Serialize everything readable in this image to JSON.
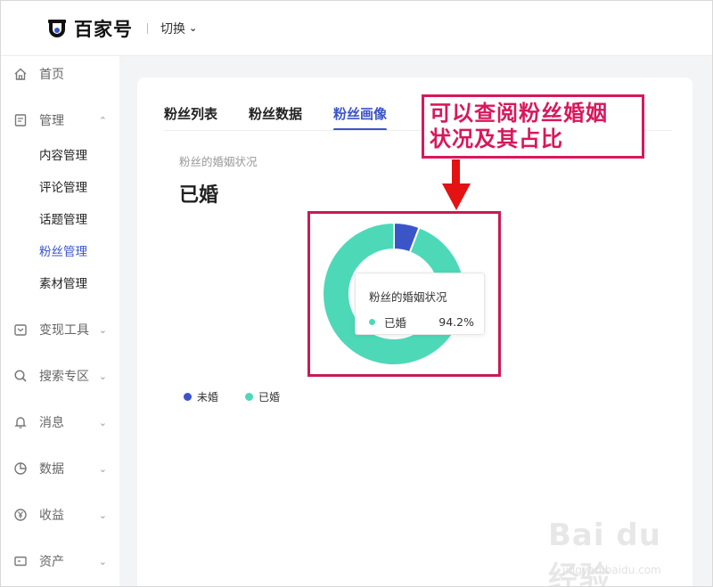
{
  "header": {
    "logo_text": "百家号",
    "switch_label": "切换"
  },
  "sidebar": {
    "home": "首页",
    "manage": "管理",
    "manage_sub": [
      "内容管理",
      "评论管理",
      "话题管理",
      "粉丝管理",
      "素材管理"
    ],
    "monetize": "变现工具",
    "search": "搜索专区",
    "messages": "消息",
    "data": "数据",
    "income": "收益",
    "assets": "资产"
  },
  "tabs": [
    "粉丝列表",
    "粉丝数据",
    "粉丝画像"
  ],
  "section": {
    "label": "粉丝的婚姻状况",
    "big_value": "已婚"
  },
  "tooltip": {
    "title": "粉丝的婚姻状况",
    "series": "已婚",
    "value": "94.2%"
  },
  "chart_data": {
    "type": "pie",
    "donut": true,
    "title": "粉丝的婚姻状况",
    "categories": [
      "未婚",
      "已婚"
    ],
    "values": [
      5.8,
      94.2
    ],
    "unit": "%",
    "colors": [
      "#3b55c9",
      "#4dd9b8"
    ],
    "legend_position": "bottom-left"
  },
  "annotation": {
    "line1": "可以查阅粉丝婚姻",
    "line2": "状况及其占比"
  },
  "watermark": {
    "main": "Bai du 经验",
    "sub": "jingyan.baidu.com"
  }
}
